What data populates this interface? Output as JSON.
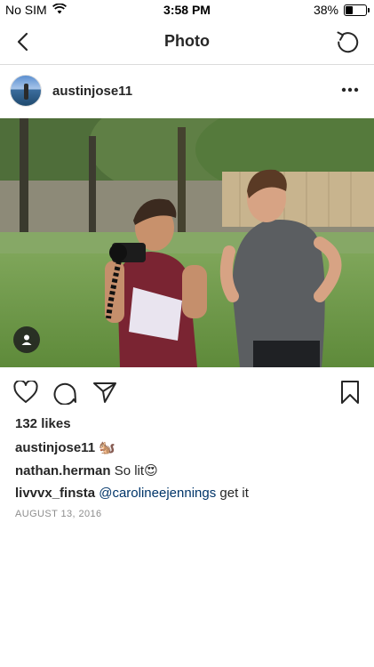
{
  "status_bar": {
    "carrier": "No SIM",
    "time": "3:58 PM",
    "battery": "38%",
    "battery_level": 0.38
  },
  "nav": {
    "title": "Photo"
  },
  "post": {
    "username": "austinjose11",
    "likes": "132 likes",
    "caption": {
      "username": "austinjose11",
      "emoji": "🐿️"
    },
    "comments": [
      {
        "username": "nathan.herman",
        "text": "So lit",
        "emoji": "😍"
      },
      {
        "username": "livvvx_finsta",
        "mention": "@carolineejennings",
        "text": "get it"
      }
    ],
    "date": "AUGUST 13, 2016"
  },
  "icons": {
    "back": "chevron-left-icon",
    "refresh": "refresh-icon",
    "more": "more-options-icon",
    "like": "heart-icon",
    "comment": "comment-icon",
    "share": "direct-send-icon",
    "save": "bookmark-icon",
    "tag": "user-tag-icon"
  }
}
